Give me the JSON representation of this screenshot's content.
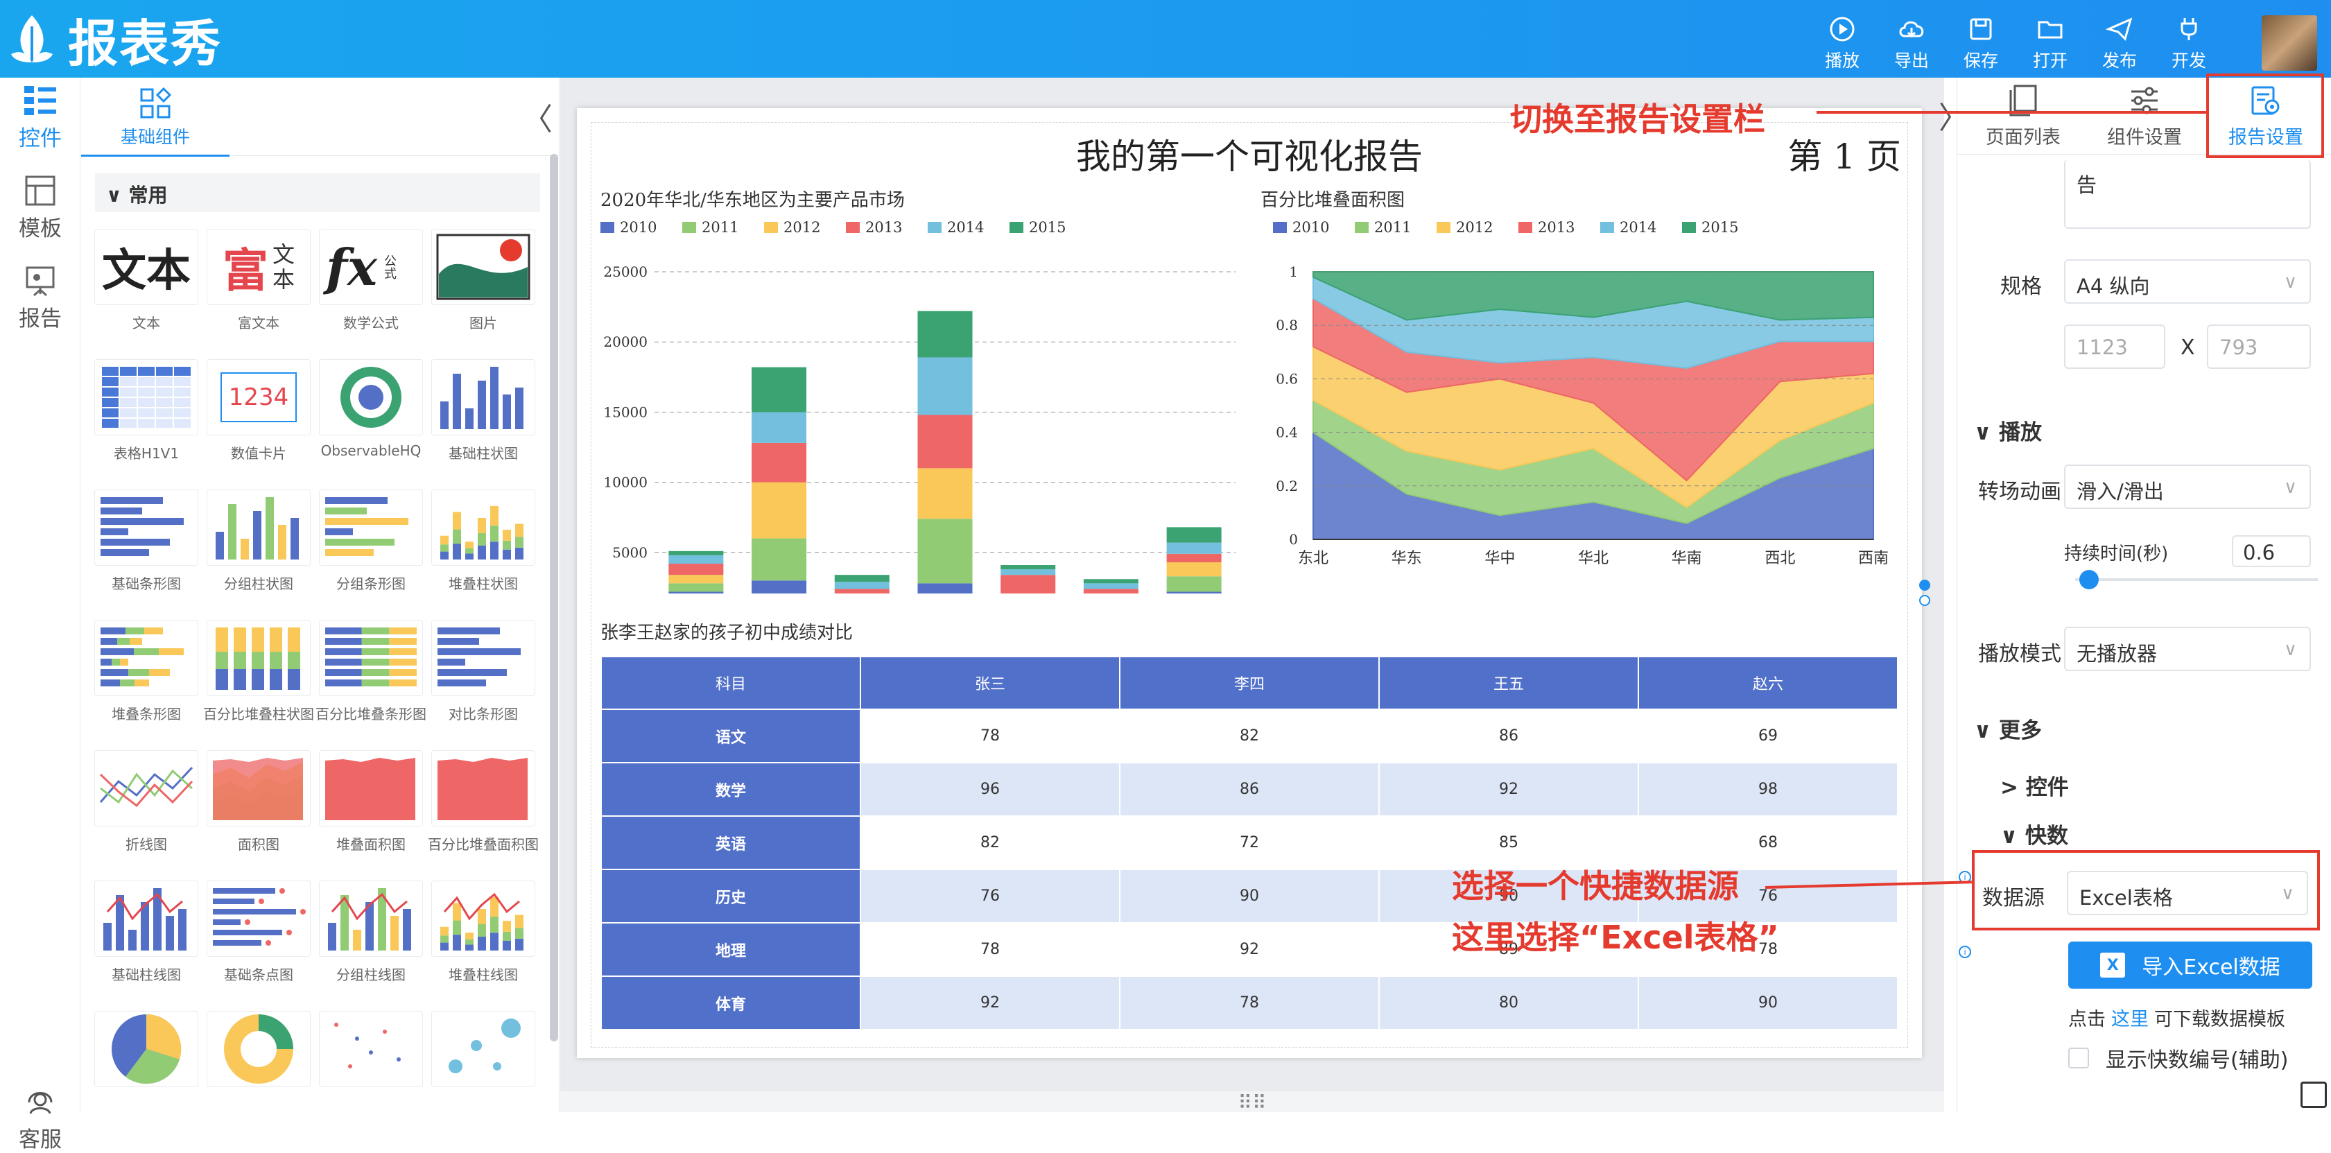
{
  "app": {
    "name": "报表秀"
  },
  "toolbar": {
    "play": "播放",
    "export": "导出",
    "save": "保存",
    "open": "打开",
    "publish": "发布",
    "develop": "开发"
  },
  "left_nav": {
    "widgets": "控件",
    "templates": "模板",
    "reports": "报告",
    "support": "客服"
  },
  "component_panel": {
    "tab": "基础组件",
    "group": "常用",
    "items": [
      "文本",
      "富文本",
      "数学公式",
      "图片",
      "表格H1V1",
      "数值卡片",
      "ObservableHQ",
      "基础柱状图",
      "基础条形图",
      "分组柱状图",
      "分组条形图",
      "堆叠柱状图",
      "堆叠条形图",
      "百分比堆叠柱状图",
      "百分比堆叠条形图",
      "对比条形图",
      "折线图",
      "面积图",
      "堆叠面积图",
      "百分比堆叠面积图",
      "基础柱线图",
      "基础条点图",
      "分组柱线图",
      "堆叠柱线图"
    ],
    "thumb_text": {
      "text": "文本",
      "rich1": "富",
      "rich2": "文",
      "rich3": "本",
      "fx": "fx",
      "fx_side": "公式",
      "card": "1234"
    }
  },
  "report": {
    "title": "我的第一个可视化报告",
    "page_label": "第 1 页",
    "table_title": "张李王赵家的孩子初中成绩对比",
    "table": {
      "headers": [
        "科目",
        "张三",
        "李四",
        "王五",
        "赵六"
      ],
      "rows": [
        [
          "语文",
          "78",
          "82",
          "86",
          "69"
        ],
        [
          "数学",
          "96",
          "86",
          "92",
          "98"
        ],
        [
          "英语",
          "82",
          "72",
          "85",
          "68"
        ],
        [
          "历史",
          "76",
          "90",
          "90",
          "76"
        ],
        [
          "地理",
          "78",
          "92",
          "89",
          "78"
        ],
        [
          "体育",
          "92",
          "78",
          "80",
          "90"
        ]
      ]
    }
  },
  "right_panel": {
    "tabs": {
      "page_list": "页面列表",
      "widget_settings": "组件设置",
      "report_settings": "报告设置"
    },
    "partial_text": "告",
    "size_label": "规格",
    "size_value": "A4 纵向",
    "width_ph": "1123",
    "times": "X",
    "height_ph": "793",
    "play_section": "播放",
    "transition_label": "转场动画",
    "transition_value": "滑入/滑出",
    "duration_label": "持续时间(秒)",
    "duration_value": "0.6",
    "duration_fraction": 0.05,
    "play_mode_label": "播放模式",
    "play_mode_value": "无播放器",
    "more_section": "更多",
    "widgets_section": "控件",
    "quickdata_section": "快数",
    "datasource_label": "数据源",
    "datasource_value": "Excel表格",
    "import_button": "导入Excel数据",
    "xl_glyph": "X",
    "hint_prefix": "点击",
    "hint_link": "这里",
    "hint_suffix": "可下载数据模板",
    "show_numbers": "显示快数编号(辅助)"
  },
  "annotations": {
    "switch": "切换至报告设置栏",
    "pick1": "选择一个快捷数据源",
    "pick2": "这里选择“Excel表格”"
  },
  "colors": {
    "accent": "#1e8ff0",
    "annotation": "#e53a2e",
    "table_header": "#5170c9"
  },
  "chart_data": [
    {
      "type": "bar",
      "stacked": true,
      "title": "2020年华北/华东地区为主要产品市场",
      "categories": [
        "东北",
        "华东",
        "华中",
        "华北",
        "华南",
        "西北",
        "西南"
      ],
      "series": [
        {
          "name": "2010",
          "color": "#5470c6",
          "values": [
            2200,
            3000,
            400,
            2800,
            500,
            600,
            2200
          ]
        },
        {
          "name": "2011",
          "color": "#91cc75",
          "values": [
            600,
            3000,
            600,
            4600,
            700,
            800,
            1100
          ]
        },
        {
          "name": "2012",
          "color": "#fac858",
          "values": [
            600,
            4000,
            800,
            3600,
            600,
            500,
            1000
          ]
        },
        {
          "name": "2013",
          "color": "#ee6666",
          "values": [
            800,
            2800,
            600,
            3800,
            1600,
            500,
            600
          ]
        },
        {
          "name": "2014",
          "color": "#73c0de",
          "values": [
            600,
            2200,
            500,
            4100,
            400,
            400,
            800
          ]
        },
        {
          "name": "2015",
          "color": "#3ba272",
          "values": [
            300,
            3200,
            500,
            3300,
            300,
            300,
            1100
          ]
        }
      ],
      "ylim": [
        0,
        25000
      ],
      "yticks": [
        "0",
        "5000",
        "10000",
        "15000",
        "20000",
        "25000"
      ],
      "grid": true,
      "legend": "top-left"
    },
    {
      "type": "area",
      "stacked": true,
      "percent": true,
      "title": "百分比堆叠面积图",
      "categories": [
        "东北",
        "华东",
        "华中",
        "华北",
        "华南",
        "西北",
        "西南"
      ],
      "series": [
        {
          "name": "2010",
          "color": "#5470c6",
          "values": [
            0.4,
            0.17,
            0.09,
            0.14,
            0.06,
            0.23,
            0.34
          ]
        },
        {
          "name": "2011",
          "color": "#91cc75",
          "values": [
            0.12,
            0.16,
            0.17,
            0.2,
            0.06,
            0.14,
            0.17
          ]
        },
        {
          "name": "2012",
          "color": "#fac858",
          "values": [
            0.2,
            0.22,
            0.34,
            0.17,
            0.1,
            0.22,
            0.11
          ]
        },
        {
          "name": "2013",
          "color": "#ee6666",
          "values": [
            0.18,
            0.15,
            0.06,
            0.17,
            0.42,
            0.15,
            0.12
          ]
        },
        {
          "name": "2014",
          "color": "#73c0de",
          "values": [
            0.08,
            0.12,
            0.2,
            0.15,
            0.25,
            0.08,
            0.09
          ]
        },
        {
          "name": "2015",
          "color": "#3ba272",
          "values": [
            0.02,
            0.18,
            0.14,
            0.17,
            0.11,
            0.18,
            0.17
          ]
        }
      ],
      "ylim": [
        0,
        1
      ],
      "yticks": [
        "0",
        "0.2",
        "0.4",
        "0.6",
        "0.8",
        "1"
      ],
      "grid": true,
      "legend": "top-left"
    }
  ]
}
